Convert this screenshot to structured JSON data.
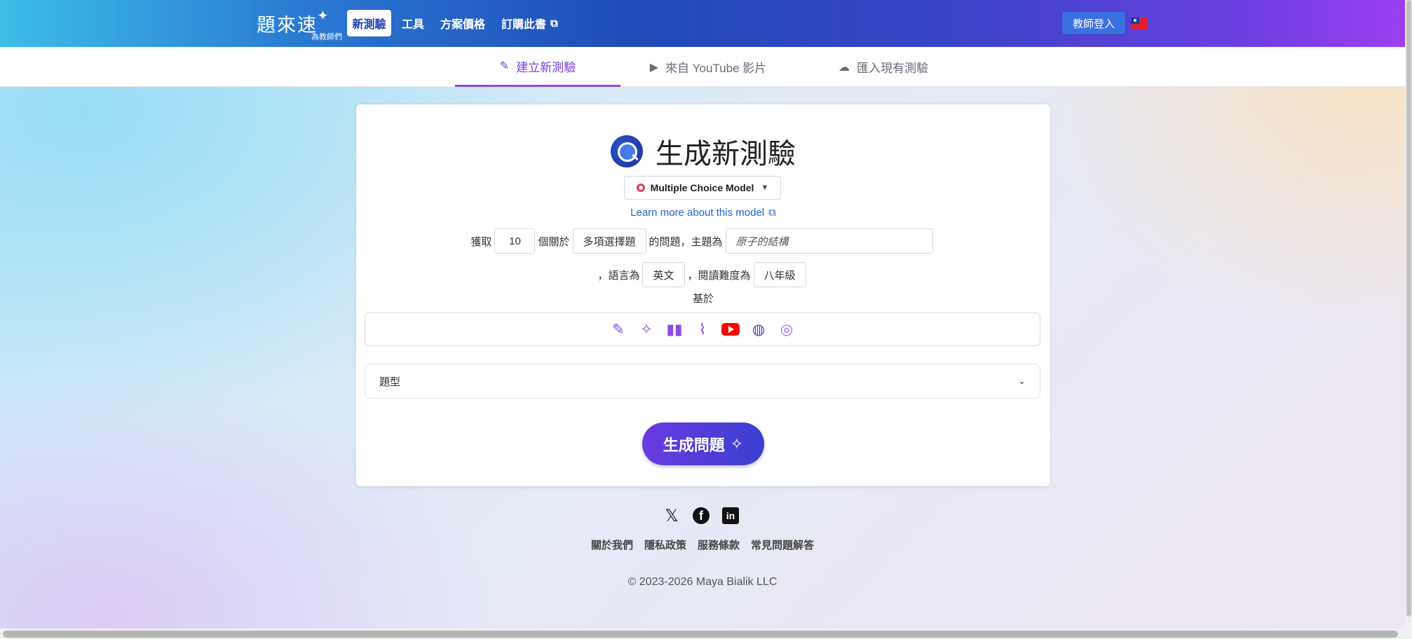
{
  "header": {
    "logo_main": "題來速",
    "logo_sub": "為教師們",
    "nav": {
      "new_quiz": "新測驗",
      "tools": "工具",
      "pricing": "方案價格",
      "subscribe": "訂購此書"
    },
    "login_label": "教師登入"
  },
  "tabs": {
    "new": "建立新測驗",
    "youtube": "來自 YouTube 影片",
    "import": "匯入現有測驗"
  },
  "card": {
    "title": "生成新測驗",
    "model_label": "Multiple Choice Model",
    "learn_more": "Learn more about this model",
    "form": {
      "get_label": "獲取",
      "count": "10",
      "about_label": "個關於",
      "qtype_value": "多項選擇題",
      "topic_label": "的問題，主題為",
      "topic_placeholder": "原子的結構",
      "lang_label": "，語言為",
      "language": "英文",
      "level_label": "，閱讀難度為",
      "reading_level": "八年級",
      "based_on": "基於"
    },
    "sources": [
      "edit-icon",
      "magic-wand-icon",
      "book-icon",
      "paperclip-icon",
      "youtube-icon",
      "globe-icon",
      "target-icon"
    ],
    "question_type_label": "題型",
    "generate_label": "生成問題"
  },
  "footer": {
    "links": {
      "about": "關於我們",
      "privacy": "隱私政策",
      "terms": "服務條款",
      "faq": "常見問題解答"
    },
    "copyright": "© 2023-2026 Maya Bialik LLC"
  },
  "colors": {
    "accent": "#8a4be6",
    "link": "#2163d0",
    "brand_blue": "#1f3fb3"
  }
}
